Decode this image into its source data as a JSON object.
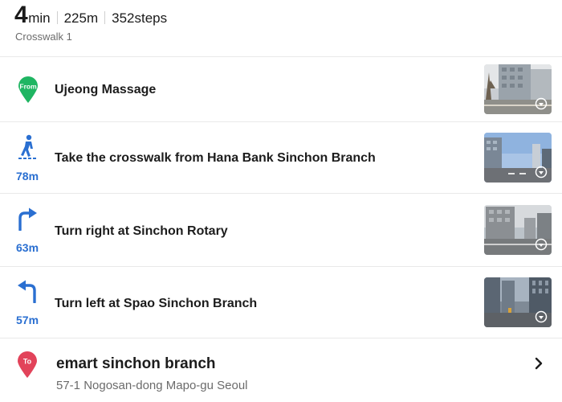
{
  "summary": {
    "time_value": "4",
    "time_unit": "min",
    "distance": "225m",
    "steps": "352steps",
    "subtitle": "Crosswalk 1"
  },
  "route": {
    "start": {
      "badge": "From",
      "name": "Ujeong Massage",
      "icon": "start-pin-icon",
      "color": "#1fb562"
    },
    "steps": [
      {
        "icon": "pedestrian-crosswalk-icon",
        "instruction": "Take the crosswalk from Hana Bank Sinchon Branch",
        "distance": "78m"
      },
      {
        "icon": "turn-right-arrow-icon",
        "instruction": "Turn right at Sinchon Rotary",
        "distance": "63m"
      },
      {
        "icon": "turn-left-arrow-icon",
        "instruction": "Turn left at Spao Sinchon Branch",
        "distance": "57m"
      }
    ],
    "destination": {
      "badge": "To",
      "name": "emart sinchon branch",
      "address": "57-1 Nogosan-dong Mapo-gu Seoul",
      "icon": "end-pin-icon",
      "color": "#e2435a"
    }
  },
  "colors": {
    "accent": "#2a6fd1",
    "start": "#1fb562",
    "end": "#e2435a"
  }
}
